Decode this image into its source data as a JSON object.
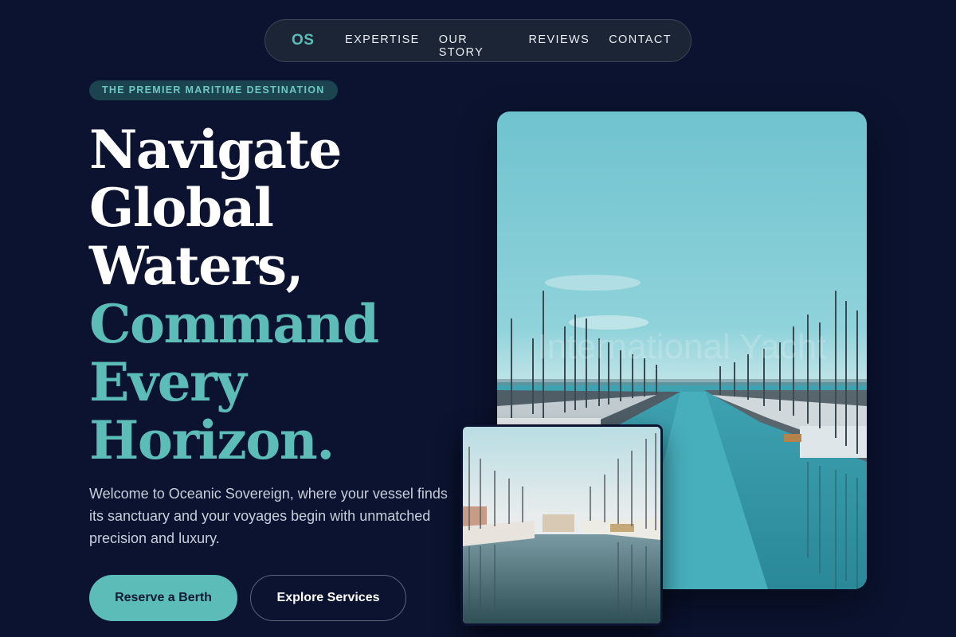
{
  "nav": {
    "logo": "OS",
    "links": [
      "EXPERTISE",
      "OUR STORY",
      "REVIEWS",
      "CONTACT"
    ]
  },
  "hero": {
    "badge": "THE PREMIER MARITIME DESTINATION",
    "headline_lines_white": [
      "Navigate",
      "Global",
      "Waters,"
    ],
    "headline_lines_teal": [
      "Command",
      "Every",
      "Horizon."
    ],
    "intro": "Welcome to Oceanic Sovereign, where your vessel finds its sanctuary and your voyages begin with unmatched precision and luxury.",
    "primary_button": "Reserve a Berth",
    "secondary_button": "Explore Services"
  },
  "images": {
    "main_watermark": "International Yacht"
  },
  "colors": {
    "background": "#0b1330",
    "accent": "#5cbcb7",
    "nav_bg": "#1c2536",
    "text_muted": "#c7cfdc"
  }
}
